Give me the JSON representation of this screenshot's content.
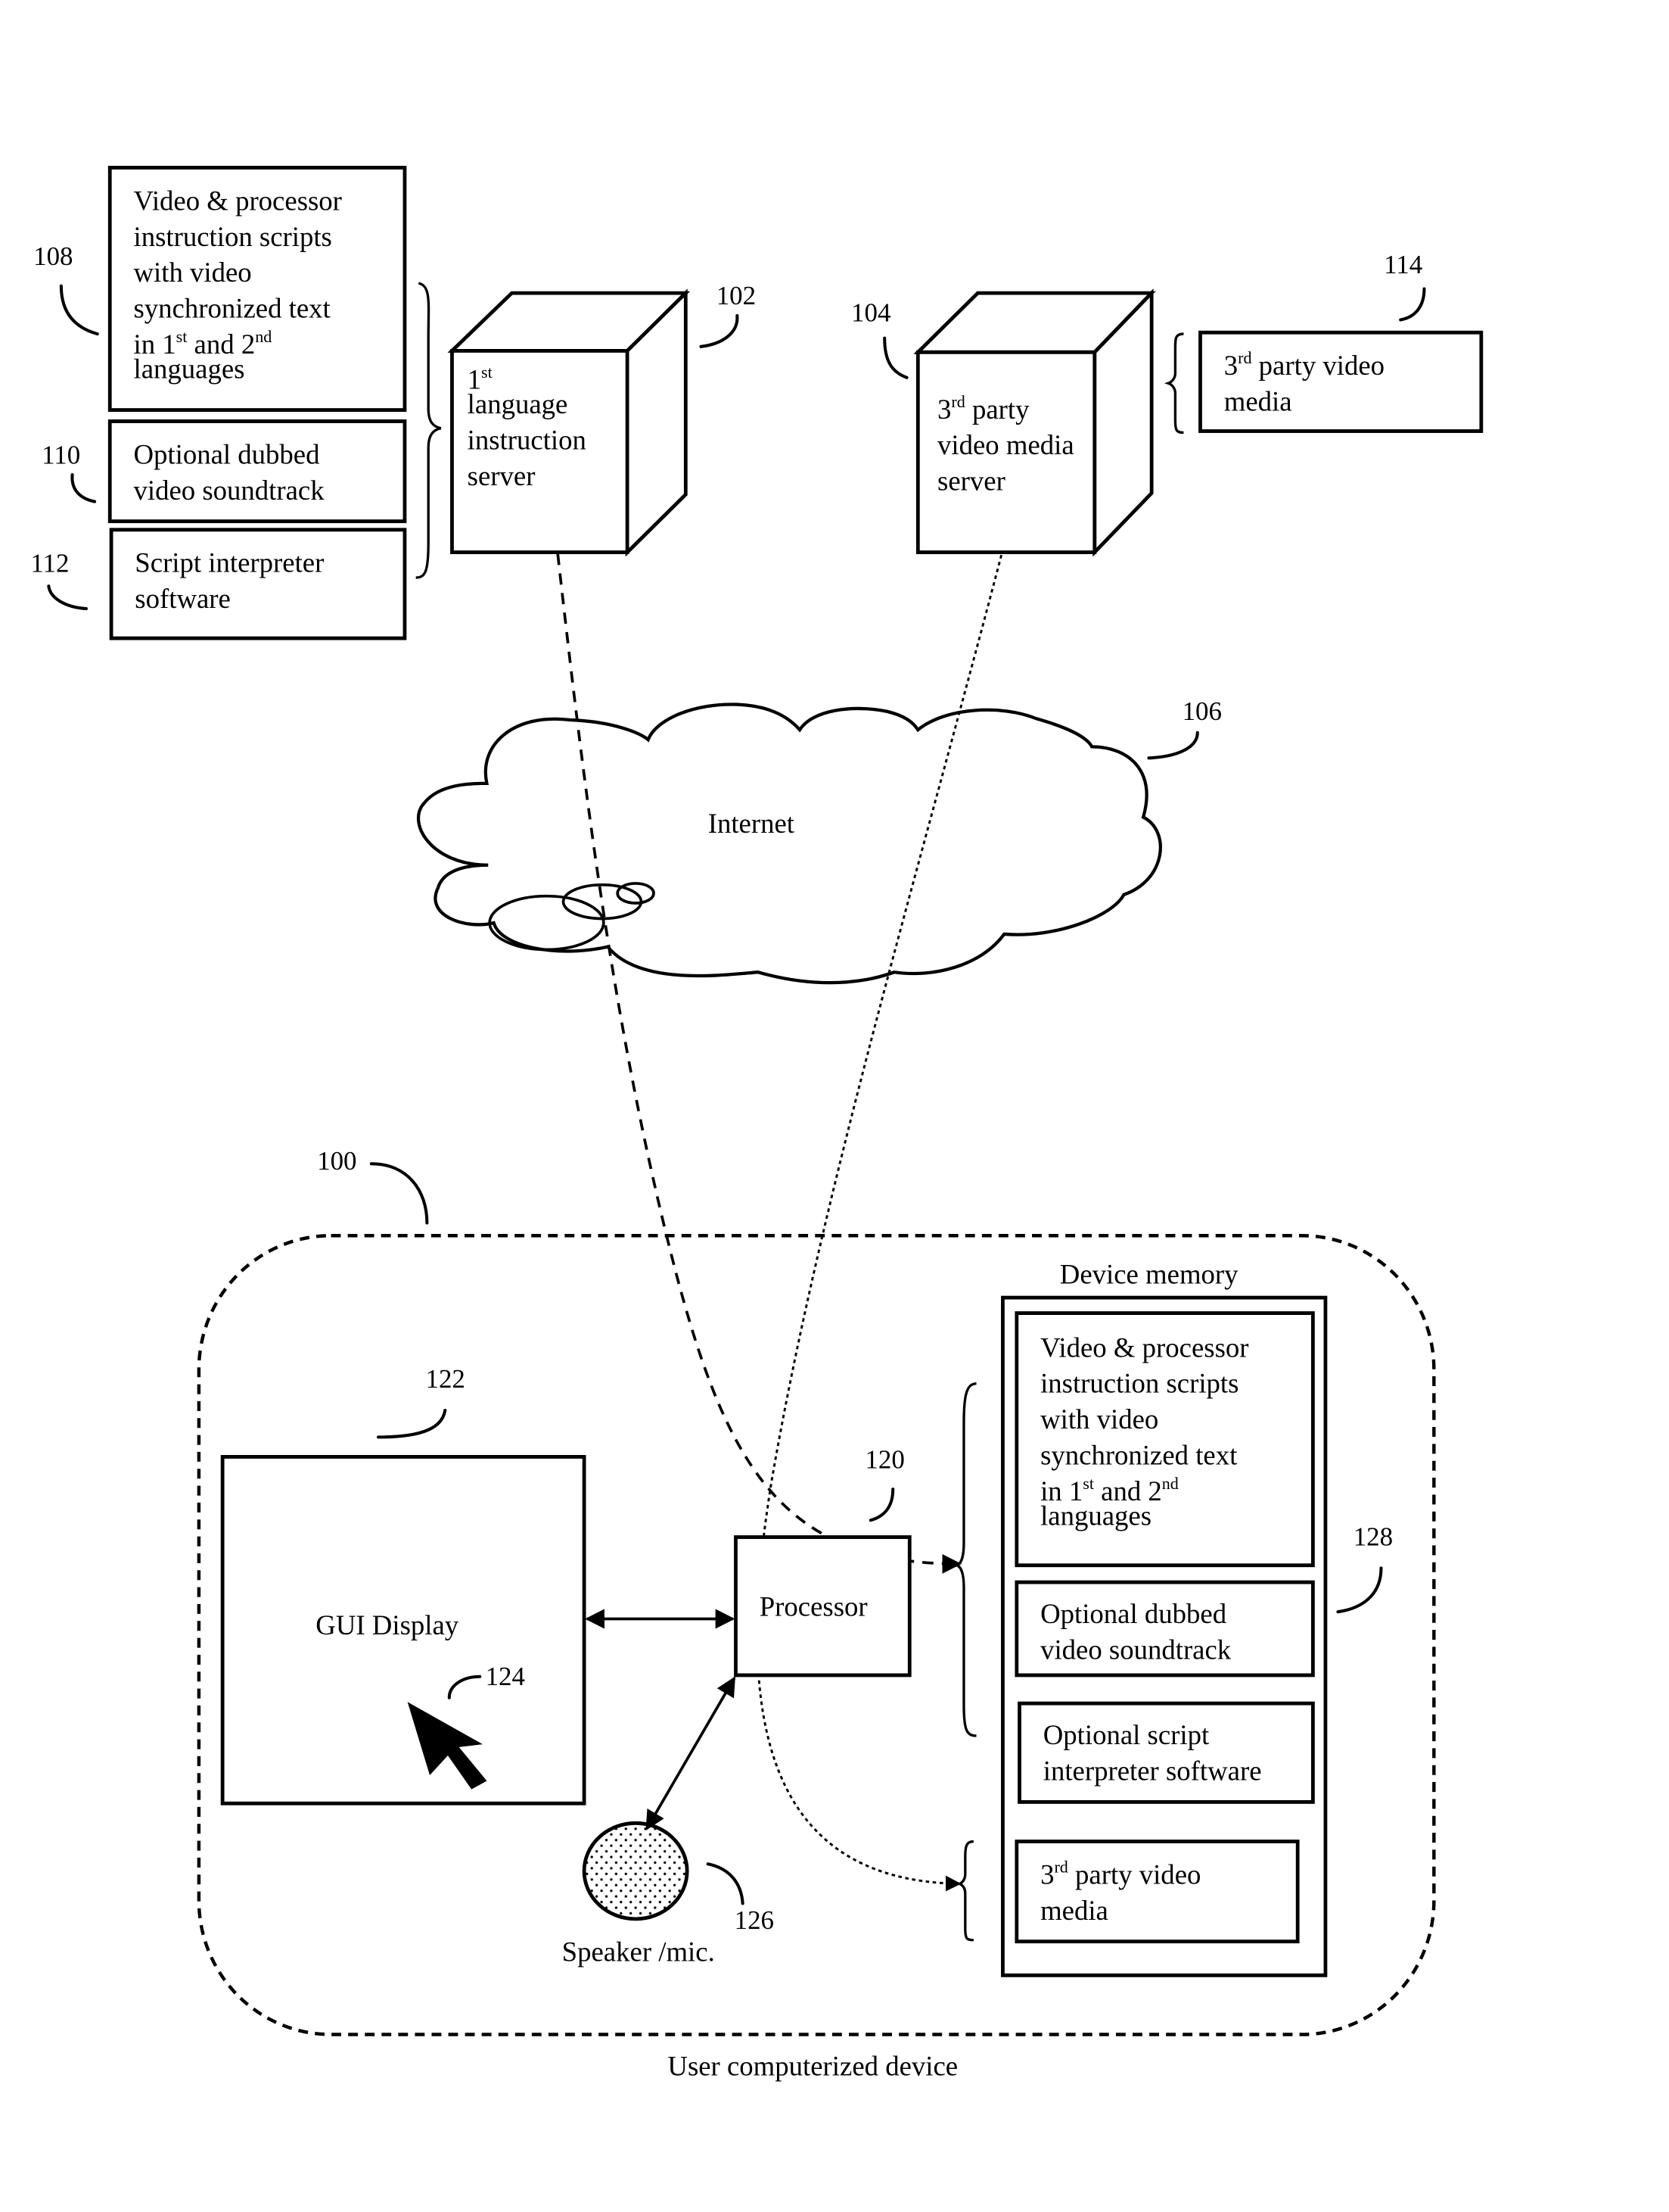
{
  "figure": {
    "server_instruction": {
      "ref": "102",
      "lines": [
        [
          "1",
          "st",
          ""
        ],
        [
          "language"
        ],
        [
          "instruction"
        ],
        [
          "server"
        ]
      ]
    },
    "server_third_party": {
      "ref": "104",
      "lines": [
        [
          "3",
          "rd",
          " party"
        ],
        [
          "video media"
        ],
        [
          "server"
        ]
      ]
    },
    "left_stack": [
      {
        "ref": "108",
        "lines": [
          [
            "Video & processor"
          ],
          [
            "instruction scripts"
          ],
          [
            "with video"
          ],
          [
            "synchronized text"
          ],
          [
            "in  1",
            "st",
            " and 2",
            "nd"
          ],
          [
            "languages"
          ]
        ]
      },
      {
        "ref": "110",
        "lines": [
          [
            "Optional dubbed"
          ],
          [
            "video soundtrack"
          ]
        ]
      },
      {
        "ref": "112",
        "lines": [
          [
            "Script interpreter"
          ],
          [
            "software"
          ]
        ]
      }
    ],
    "third_party_media_top": {
      "ref": "114",
      "lines": [
        [
          "3",
          "rd",
          " party video"
        ],
        [
          "media"
        ]
      ]
    },
    "internet": {
      "ref": "106",
      "label": "Internet"
    },
    "device": {
      "ref": "100",
      "caption": "User computerized device",
      "gui_display": {
        "ref": "122",
        "label": "GUI Display",
        "cursor_ref": "124"
      },
      "processor": {
        "ref": "120",
        "label": "Processor"
      },
      "speaker": {
        "ref": "126",
        "label": "Speaker /mic."
      },
      "memory": {
        "ref": "128",
        "title": "Device memory",
        "items": [
          {
            "lines": [
              [
                "Video & processor"
              ],
              [
                "instruction scripts"
              ],
              [
                "with video"
              ],
              [
                "synchronized text"
              ],
              [
                "in  1",
                "st",
                " and 2",
                "nd"
              ],
              [
                "languages"
              ]
            ]
          },
          {
            "lines": [
              [
                "Optional dubbed"
              ],
              [
                "video soundtrack"
              ]
            ]
          },
          {
            "lines": [
              [
                "Optional script"
              ],
              [
                "interpreter software"
              ]
            ]
          },
          {
            "lines": [
              [
                "3",
                "rd",
                " party video"
              ],
              [
                "media"
              ]
            ]
          }
        ]
      }
    }
  }
}
